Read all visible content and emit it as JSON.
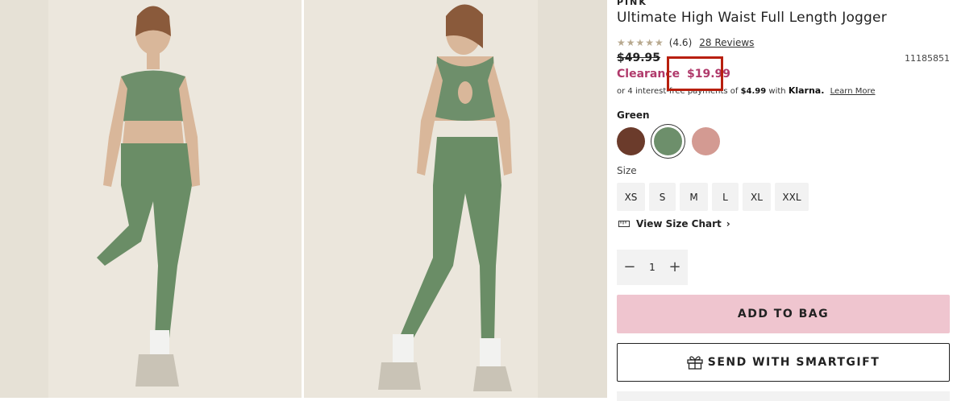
{
  "product": {
    "brand": "PINK",
    "title": "Ultimate High Waist Full Length Jogger",
    "rating_stars": "★★★★★",
    "rating_value": "(4.6)",
    "reviews_link": "28 Reviews",
    "original_price": "$49.95",
    "sku": "11185851",
    "sale_label": "Clearance",
    "sale_price": "$19.99"
  },
  "klarna": {
    "prefix": "or 4 interest-free payments of",
    "amount": "$4.99",
    "with": "with",
    "logo": "Klarna.",
    "learn_more": "Learn More"
  },
  "color": {
    "selected_name": "Green",
    "swatches": [
      {
        "name": "Brown",
        "hex": "#6b3b2b"
      },
      {
        "name": "Green",
        "hex": "#6d8f6b"
      },
      {
        "name": "Pink",
        "hex": "#d39a92"
      }
    ]
  },
  "size": {
    "label": "Size",
    "options": [
      "XS",
      "S",
      "M",
      "L",
      "XL",
      "XXL"
    ]
  },
  "size_chart_link": "View Size Chart",
  "quantity": {
    "value": "1",
    "minus": "−",
    "plus": "+"
  },
  "actions": {
    "add_to_bag": "ADD TO BAG",
    "smartgift": "SEND WITH SMARTGIFT"
  },
  "colors": {
    "sale": "#b03a6b",
    "add_bag_bg": "#efc5cf",
    "highlight": "#b81f0e"
  }
}
